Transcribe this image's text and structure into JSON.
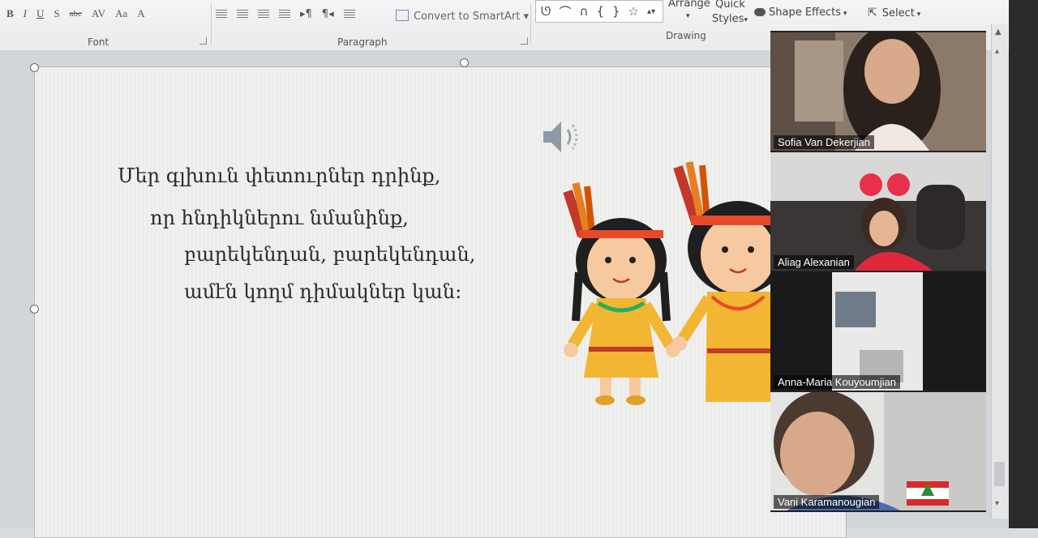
{
  "ribbon": {
    "font_tools": [
      "B",
      "I",
      "U",
      "S",
      "abc",
      "AV",
      "Aa",
      "A"
    ],
    "convert_smartart": "Convert to SmartArt",
    "arrange": "Arrange",
    "quick_styles_line1": "Quick",
    "quick_styles_line2": "Styles",
    "shape_effects": "Shape Effects",
    "select": "Select",
    "groups": {
      "font": "Font",
      "paragraph": "Paragraph",
      "drawing": "Drawing"
    }
  },
  "slide": {
    "lines": [
      "Մեր գլխուն փետուրներ դրինք,",
      "որ հնդիկներու նմանինք,",
      "բարեկենդան, բարեկենդան,",
      "ամէն կողմ դիմակներ կան:"
    ]
  },
  "participants": [
    {
      "name": "Sofia Van Dekerjian",
      "active": false
    },
    {
      "name": "Aliag Alexanian",
      "active": false
    },
    {
      "name": "Anna-Maria Kouyoumjian",
      "active": false
    },
    {
      "name": "Vani Karamanougian",
      "active": true
    }
  ],
  "colors": {
    "active_border": "#6fbf3d",
    "kid_outfit": "#f2b632",
    "feather_red": "#c0392b"
  }
}
